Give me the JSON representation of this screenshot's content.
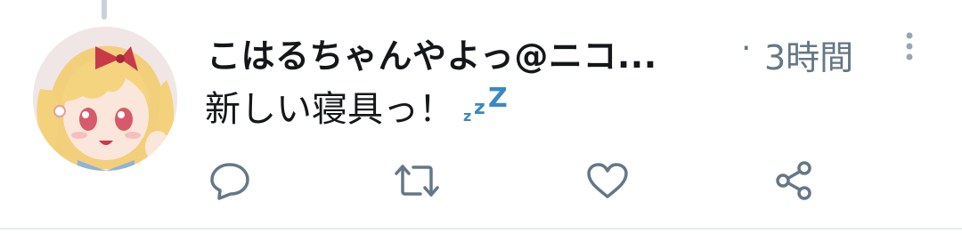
{
  "tweet": {
    "display_name": "こはるちゃんやよっ@ニコ...",
    "separator": "·",
    "timestamp": "3時間",
    "text": "新しい寝具っ！"
  },
  "icons": {
    "text_emoji": "zzz-icon",
    "more": "more-vertical-icon",
    "reply": "reply-icon",
    "retweet": "retweet-icon",
    "like": "heart-icon",
    "share": "share-icon"
  },
  "colors": {
    "text_primary": "#14171a",
    "text_secondary": "#657786",
    "zzz_blue": "#3b88c3",
    "thread_line": "#c9d2d9",
    "divider": "#e6ecf0"
  }
}
